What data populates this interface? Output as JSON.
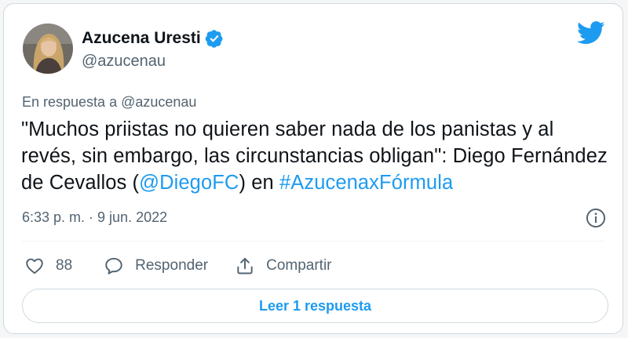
{
  "author": {
    "name": "Azucena Uresti",
    "handle": "@azucenau",
    "verified": true
  },
  "reply_to": "En respuesta a @azucenau",
  "tweet": {
    "text_part1": "\"Muchos priistas no quieren saber nada de los panistas y al revés, sin embargo, las circunstancias obligan\": Diego Fernández de Cevallos (",
    "mention": "@DiegoFC",
    "text_part2": ") en ",
    "hashtag": "#AzucenaxFórmula"
  },
  "timestamp": "6:33 p. m. · 9 jun. 2022",
  "actions": {
    "like_count": "88",
    "reply_label": "Responder",
    "share_label": "Compartir"
  },
  "read_replies_label": "Leer 1 respuesta",
  "icons": {
    "verified": "verified-badge-icon",
    "brand": "twitter-bird-icon",
    "info": "info-icon",
    "like": "heart-icon",
    "reply": "speech-bubble-icon",
    "share": "share-icon"
  },
  "colors": {
    "accent": "#1d9bf0",
    "text": "#0f1419",
    "secondary": "#536471",
    "border": "#cfd9de"
  }
}
